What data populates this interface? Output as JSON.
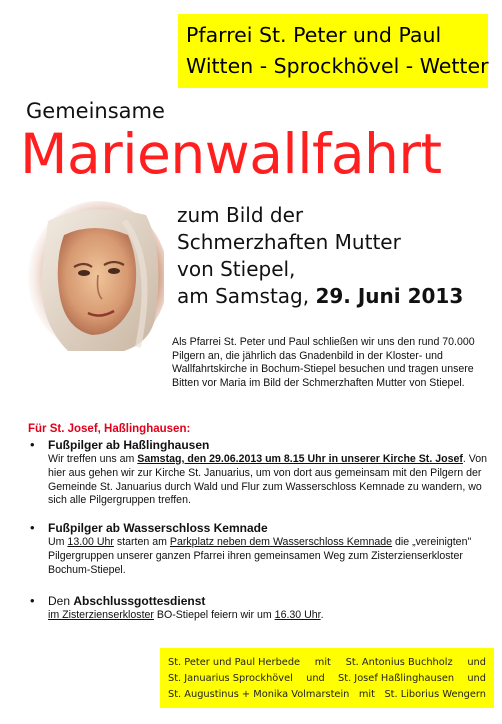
{
  "header": {
    "line1": "Pfarrei  St. Peter und Paul",
    "line2": "Witten - Sprockhövel - Wetter"
  },
  "intro_word": "Gemeinsame",
  "title": "Marienwallfahrt",
  "portrait_icon": "madonna-painting-icon",
  "subtitle": {
    "line1": "zum Bild der",
    "line2": "Schmerzhaften Mutter",
    "line3": "von Stiepel,",
    "line4_prefix": "am Samstag, ",
    "line4_date": "29. Juni 2013"
  },
  "intro_text": "Als Pfarrei St. Peter und Paul schließen wir uns den rund 70.000 Pilgern an, die jährlich das Gnadenbild in der Kloster- und Wallfahrtskirche in Bochum-Stiepel besuchen und tragen unsere Bitten vor Maria im Bild der Schmerzhaften Mutter von Stiepel.",
  "section_heading": "Für St. Josef, Haßlinghausen:",
  "items": [
    {
      "bullet": "•",
      "head": "Fußpilger ab Haßlinghausen",
      "p1": "Wir treffen uns am ",
      "p2": "Samstag, den 29.06.2013 um 8.15 Uhr in unserer Kirche St. Josef",
      "p3": ". Von hier aus gehen wir zur Kirche St. Januarius, um von dort aus gemeinsam mit den Pilgern der Gemeinde St. Januarius durch Wald und Flur zum Wasserschloss Kemnade zu wandern, wo sich alle Pilgergruppen treffen."
    },
    {
      "bullet": "•",
      "head": "Fußpilger ab Wasserschloss Kemnade",
      "p1": "Um ",
      "p2": "13.00 Uhr",
      "p3": " starten am ",
      "p4": "Parkplatz neben dem Wasserschloss Kemnade",
      "p5": " die „vereinigten\" Pilgergruppen unserer ganzen Pfarrei ihren gemeinsamen Weg zum Zisterzienserkloster Bochum-Stiepel."
    },
    {
      "bullet": "•",
      "p1": "Den ",
      "head": "Abschlussgottesdienst",
      "p2": "im Zisterzienserkloster",
      "p3": " BO-Stiepel feiern wir um ",
      "p4": "16.30 Uhr",
      "p5": "."
    }
  ],
  "footer": {
    "r1a": "St. Peter und Paul Herbede",
    "r1b": "mit",
    "r1c": "St. Antonius Buchholz",
    "r1d": "und",
    "r2a": "St. Januarius Sprockhövel",
    "r2b": "und",
    "r2c": "St. Josef Haßlinghausen",
    "r2d": "und",
    "r3a": "St. Augustinus + Monika Volmarstein",
    "r3b": "mit",
    "r3c": "St. Liborius Wengern"
  },
  "colors": {
    "header_bg": "#ffff00",
    "title": "#ff1f1f",
    "section_heading": "#e2001a"
  }
}
